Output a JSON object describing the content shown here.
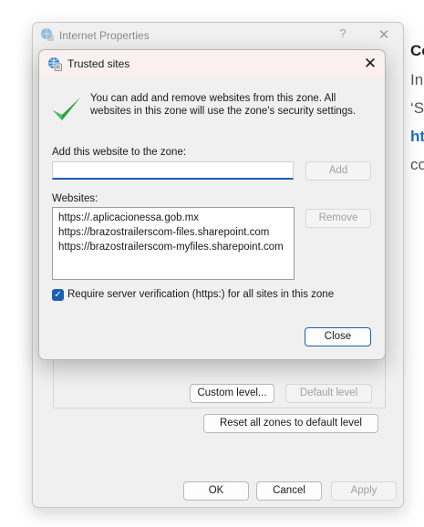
{
  "background": {
    "frag1": "Co",
    "frag2": "In",
    "frag3": "‘S",
    "frag4": "ht",
    "frag5": "co"
  },
  "parent_window": {
    "title": "Internet Properties",
    "help_glyph": "?",
    "close_glyph": "✕",
    "custom_level_label": "Custom level...",
    "default_level_label": "Default level",
    "reset_all_label": "Reset all zones to default level",
    "ok_label": "OK",
    "cancel_label": "Cancel",
    "apply_label": "Apply"
  },
  "dialog": {
    "title": "Trusted sites",
    "close_glyph": "✕",
    "info_text": "You can add and remove websites from this zone. All websites in this zone will use the zone's security settings.",
    "add_label": "Add this website to the zone:",
    "add_input_value": "",
    "add_button": "Add",
    "websites_label": "Websites:",
    "websites": [
      "https://.aplicacionessa.gob.mx",
      "https://brazostrailerscom-files.sharepoint.com",
      "https://brazostrailerscom-myfiles.sharepoint.com"
    ],
    "remove_button": "Remove",
    "require_https_label": "Require server verification (https:) for all sites in this zone",
    "require_https_checked": true,
    "close_button": "Close"
  },
  "colors": {
    "accent": "#1a5fb4",
    "check_green": "#2e9e3a",
    "dialog_titlebar": "#faf0ef",
    "window_bg": "#f0f0f0"
  }
}
